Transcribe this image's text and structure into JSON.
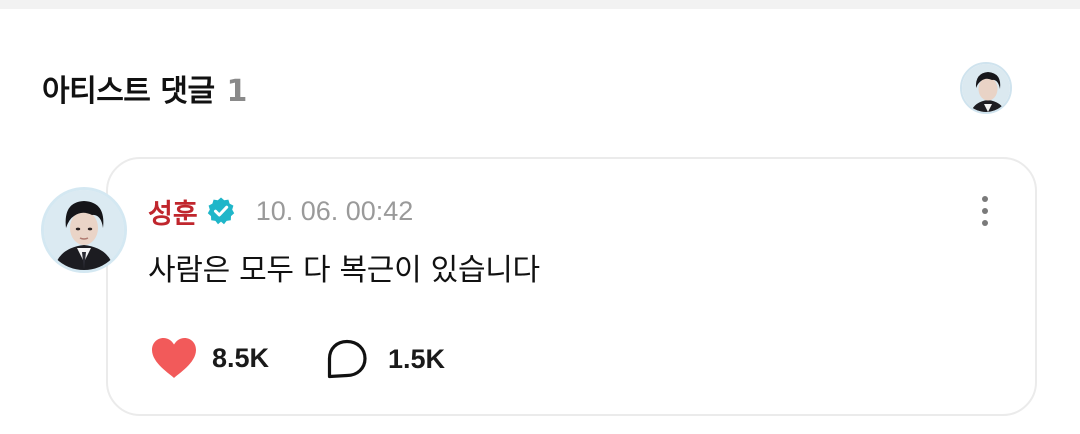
{
  "section": {
    "title": "아티스트 댓글",
    "count": "1"
  },
  "comment": {
    "author": "성훈",
    "verified_icon": "verified-check-icon",
    "timestamp": "10. 06. 00:42",
    "text": "사람은 모두 다 복근이 있습니다",
    "likes": "8.5K",
    "replies": "1.5K",
    "more_icon": "more-vertical-icon"
  },
  "colors": {
    "author": "#c0262d",
    "verified": "#1fb6c9",
    "like": "#f25a5a",
    "timestamp": "#9a9a9a"
  }
}
